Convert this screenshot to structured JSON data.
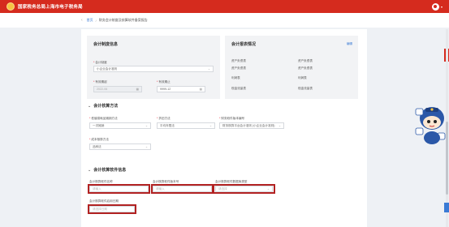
{
  "header": {
    "site_title": "国家税务总局上海市电子税务局"
  },
  "breadcrumb": {
    "home": "首页",
    "current": "财务会计制度及核算软件备案报告"
  },
  "accounting_basic": {
    "title": "会计制度信息",
    "accounting_system_label": "会计制度",
    "accounting_system_value": "小企业会计准则",
    "valid_from_label": "有效期起",
    "valid_from_value": "2022-06",
    "valid_to_label": "有效期止",
    "valid_to_value": "9999-12"
  },
  "report_info": {
    "title": "会计报表情况",
    "link": "编辑",
    "items": [
      "资产负债表",
      "资产负债表",
      "资产负债表",
      "资产负债表",
      "利润表",
      "利润表",
      "现金流量表",
      "现金流量表"
    ]
  },
  "method": {
    "title": "会计核算方法",
    "depreciation_label": "低值易耗品摊销方法",
    "depreciation_value": "一次摊销",
    "cost_label": "折旧方法",
    "cost_value": "平均年限法",
    "inventory_label": "财务软件版本编号",
    "inventory_value": "财务核算平台会计准则 (小企业会计准则)",
    "costing_label": "成本核算方法",
    "costing_value": "品种法"
  },
  "software": {
    "title": "会计核算软件信息",
    "name_label": "会计核算软件名称",
    "name_placeholder": "请输入",
    "version_label": "会计核算软件版本号",
    "version_placeholder": "请输入",
    "db_label": "会计核算软件数据库类型",
    "db_placeholder": "请选择",
    "date_label": "会计核算软件启用日期",
    "date_placeholder": "请选择日期"
  },
  "icons": {
    "calendar": "calendar-icon",
    "chevron": "chevron-down-icon"
  },
  "colors": {
    "brand": "#d52b1e",
    "link": "#3a7bd5",
    "highlight": "#b22222"
  }
}
